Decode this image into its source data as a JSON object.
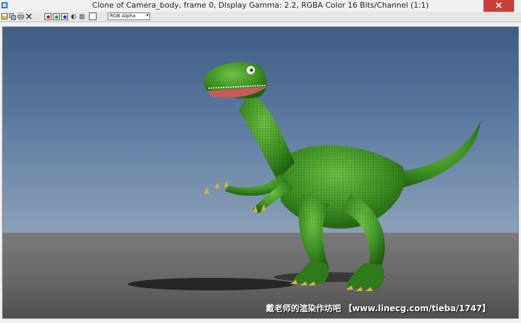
{
  "window": {
    "title": "Clone of Camera_body, frame 0, Display Gamma: 2.2, RGBA Color 16 Bits/Channel (1:1)",
    "close_label": "×"
  },
  "toolbar": {
    "icons": [
      "save-image-icon",
      "clone-window-icon",
      "print-icon",
      "clear-icon"
    ],
    "channels": [
      {
        "name": "red",
        "color": "#d11a1a"
      },
      {
        "name": "green",
        "color": "#1a9e2a"
      },
      {
        "name": "blue",
        "color": "#1a2fd1"
      }
    ],
    "channel_select": "RGB Alpha"
  },
  "render": {
    "subject": "dinosaur-render",
    "sky_color": "#4f6d93",
    "ground_color": "#6a6a6a",
    "body_color": "#3c8f22"
  },
  "watermark": "戴老师的渲染作坊吧  【www.linecg.com/tieba/1747】"
}
